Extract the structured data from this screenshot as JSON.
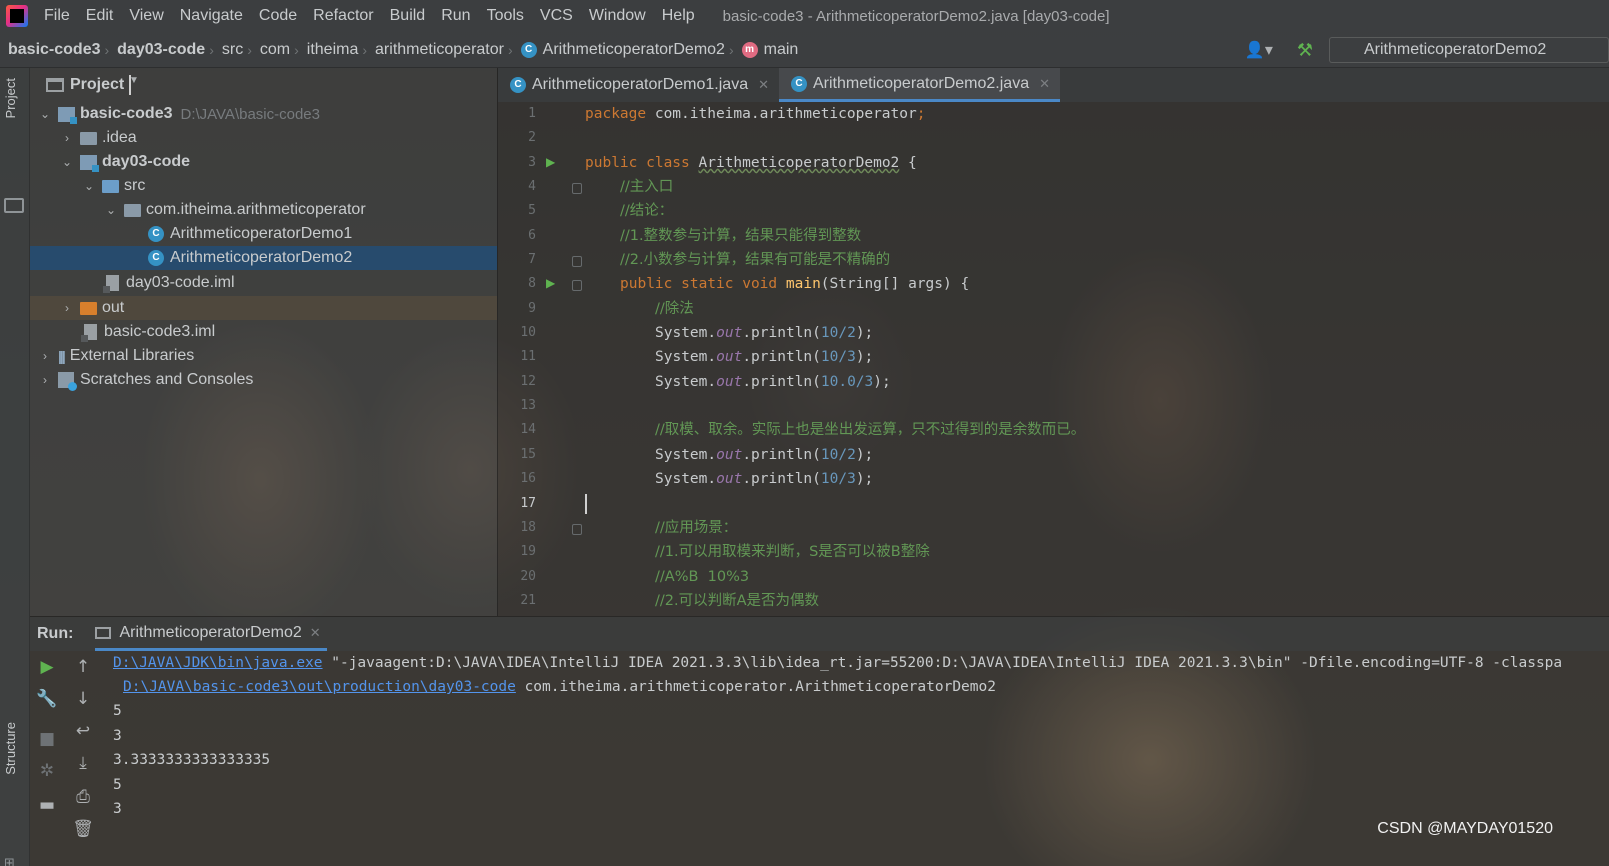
{
  "menubar": {
    "items": [
      "File",
      "Edit",
      "View",
      "Navigate",
      "Code",
      "Refactor",
      "Build",
      "Run",
      "Tools",
      "VCS",
      "Window",
      "Help"
    ],
    "window_title": "basic-code3 - ArithmeticoperatorDemo2.java [day03-code]"
  },
  "navbar": {
    "crumbs": [
      "basic-code3",
      "day03-code",
      "src",
      "com",
      "itheima",
      "arithmeticoperator",
      "ArithmeticoperatorDemo2",
      "main"
    ],
    "run_config": "ArithmeticoperatorDemo2"
  },
  "side_tabs": {
    "project": "Project",
    "structure": "Structure"
  },
  "project_panel": {
    "title": "Project",
    "tree": [
      {
        "label": "basic-code3",
        "hint": "D:\\JAVA\\basic-code3"
      },
      {
        "label": ".idea"
      },
      {
        "label": "day03-code"
      },
      {
        "label": "src"
      },
      {
        "label": "com.itheima.arithmeticoperator"
      },
      {
        "label": "ArithmeticoperatorDemo1"
      },
      {
        "label": "ArithmeticoperatorDemo2"
      },
      {
        "label": "day03-code.iml"
      },
      {
        "label": "out"
      },
      {
        "label": "basic-code3.iml"
      },
      {
        "label": "External Libraries"
      },
      {
        "label": "Scratches and Consoles"
      }
    ]
  },
  "editor": {
    "tabs": [
      {
        "label": "ArithmeticoperatorDemo1.java"
      },
      {
        "label": "ArithmeticoperatorDemo2.java"
      }
    ],
    "line_numbers": [
      "1",
      "2",
      "3",
      "4",
      "5",
      "6",
      "7",
      "8",
      "9",
      "10",
      "11",
      "12",
      "13",
      "14",
      "15",
      "16",
      "17",
      "18",
      "19",
      "20",
      "21"
    ],
    "code": {
      "l1_kw": "package",
      "l1_rest": " com.itheima.arithmeticoperator",
      "l1_semi": ";",
      "l3_kw": "public class ",
      "l3_name": "ArithmeticoperatorDemo2",
      "l3_rest": " {",
      "l4": "//主入口",
      "l5": "//结论：",
      "l6": "//1.整数参与计算，结果只能得到整数",
      "l7": "//2.小数参与计算，结果有可能是不精确的",
      "l8_kw": "public static void ",
      "l8_mth": "main",
      "l8_rest": "(String[] args) {",
      "l9": "//除法",
      "sys": "System.",
      "out": "out",
      "println": ".println(",
      "close": ");",
      "l10_arg": "10/2",
      "l11_arg": "10/3",
      "l12_arg": "10.0/3",
      "l14": "//取模、取余。实际上也是坐出发运算，只不过得到的是余数而已。",
      "l15_arg": "10/2",
      "l16_arg": "10/3",
      "l18": "//应用场景：",
      "l19": "//1.可以用取模来判断，S是否可以被B整除",
      "l20": "//A%B  10%3",
      "l21": "//2.可以判断A是否为偶数"
    }
  },
  "run_panel": {
    "label": "Run:",
    "tab": "ArithmeticoperatorDemo2",
    "console": {
      "java_exe": "D:\\JAVA\\JDK\\bin\\java.exe",
      "cmd_rest": " \"-javaagent:D:\\JAVA\\IDEA\\IntelliJ IDEA 2021.3.3\\lib\\idea_rt.jar=55200:D:\\JAVA\\IDEA\\IntelliJ IDEA 2021.3.3\\bin\" -Dfile.encoding=UTF-8 -classpa",
      "classpath": "D:\\JAVA\\basic-code3\\out\\production\\day03-code",
      "main_class": " com.itheima.arithmeticoperator.ArithmeticoperatorDemo2",
      "output": [
        "5",
        "3",
        "3.3333333333333335",
        "5",
        "3"
      ]
    }
  },
  "watermark": "CSDN @MAYDAY01520",
  "colors": {
    "keyword": "#cc7832",
    "method": "#ffc66d",
    "field": "#9876aa",
    "number": "#6897bb",
    "comment": "#629755",
    "link": "#5394ec",
    "selection": "#264c70",
    "run_green": "#5fb350"
  }
}
